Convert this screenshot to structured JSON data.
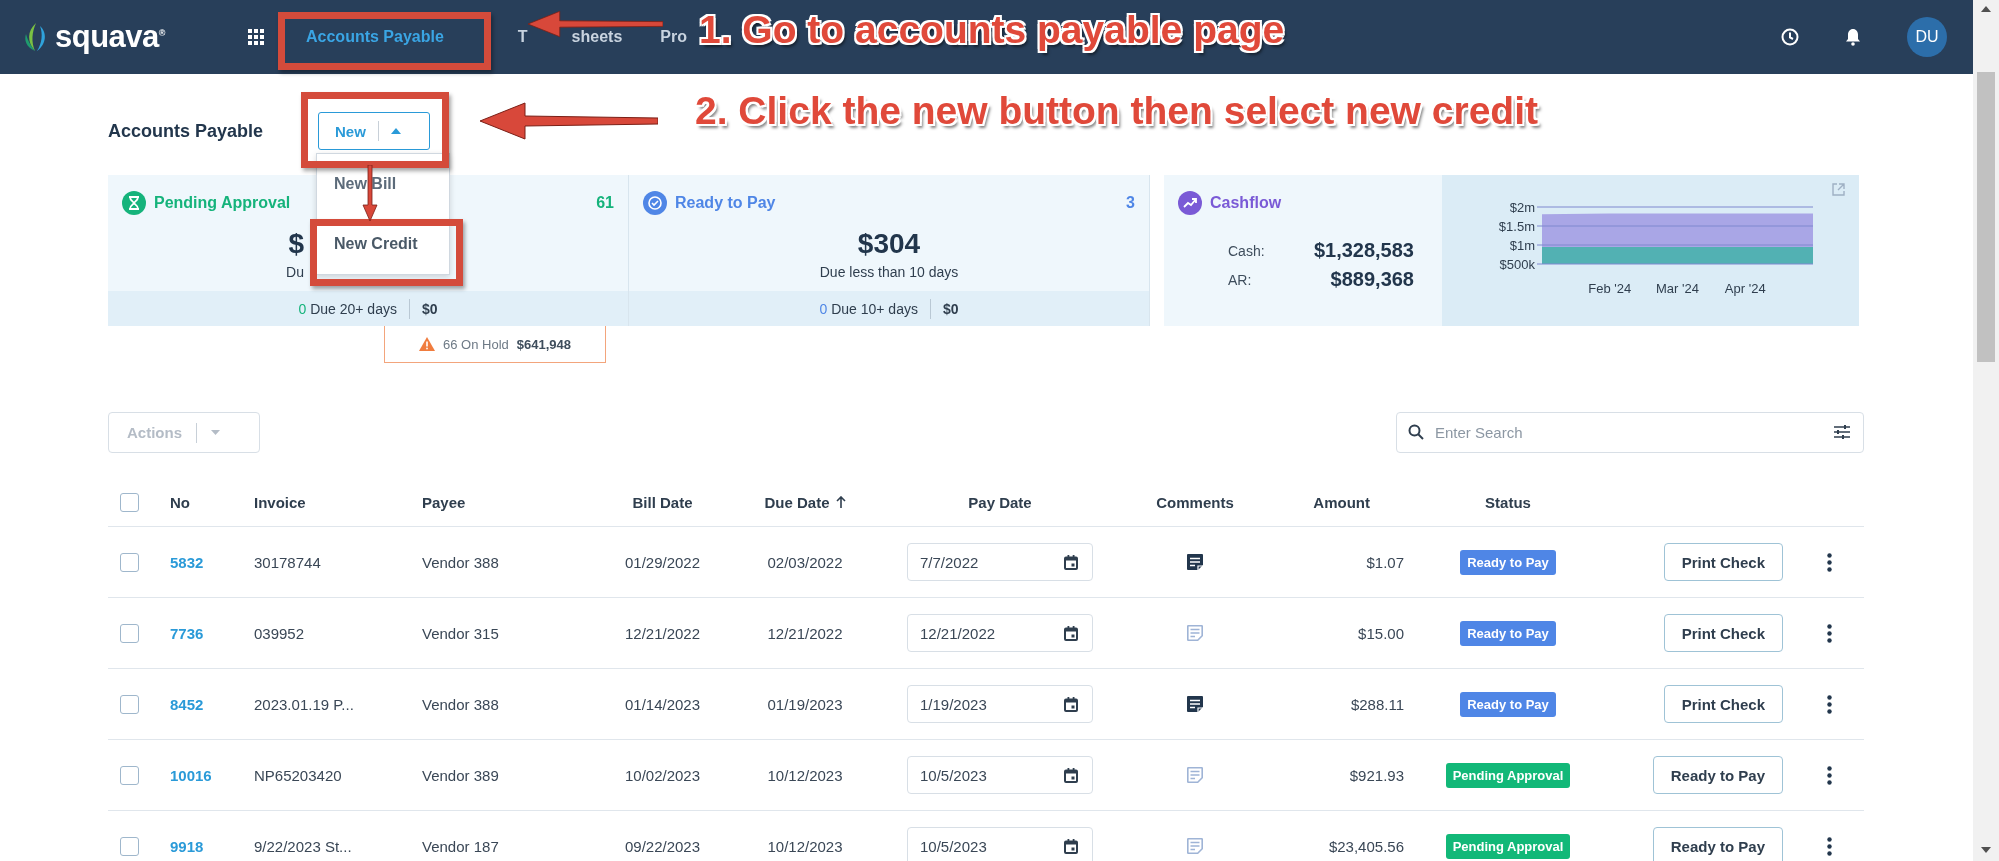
{
  "top_bar": {
    "logo": "squava$^{®}$",
    "nav": [
      {
        "label": "Accounts Payable",
        "selected": true
      },
      {
        "label": "T",
        "label_tail": "sheets",
        "selected": false
      },
      {
        "label": "Pro",
        "selected": false
      }
    ],
    "avatar": "DU"
  },
  "page_title": "Accounts Payable",
  "new_button": {
    "label": "New",
    "expanded": true,
    "menu": [
      {
        "label": "New Bill",
        "highlighted": false
      },
      {
        "label": "New Credit",
        "highlighted": true
      }
    ]
  },
  "cards": [
    {
      "title": "Pending Approval",
      "count": "61",
      "color": "#15b37b",
      "amount": "$",
      "due": "Du",
      "footer_count": "0",
      "footer_label": "Due 20+ days",
      "footer_amount": "$0"
    },
    {
      "title": "Ready to Pay",
      "count": "3",
      "color": "#4f86e6",
      "amount": "$304",
      "due": "Due less than 10 days",
      "footer_count": "0",
      "footer_label": "Due 10+ days",
      "footer_amount": "$0"
    }
  ],
  "on_hold": {
    "label": "66 On Hold",
    "amount": "$641,948"
  },
  "cashflow": {
    "title": "Cashflow",
    "cash_label": "Cash:",
    "cash": "$1,328,583",
    "ar_label": "AR:",
    "ar": "$889,368",
    "chart_data": {
      "type": "area",
      "stacked": false,
      "categories": [
        null,
        "Feb '24",
        "Mar '24",
        "Apr '24",
        null
      ],
      "series": [
        {
          "color": "#a9a6e6",
          "values": [
            1810000,
            1830000,
            1830000,
            1830000,
            1830000
          ]
        },
        {
          "color": "#52b1b3",
          "values": [
            950000,
            950000,
            950000,
            950000,
            950000
          ]
        }
      ],
      "ylim": [
        500000,
        2000000
      ],
      "yticks": [
        {
          "value": 500000,
          "label": "$500k"
        },
        {
          "value": 1000000,
          "label": "$1m"
        },
        {
          "value": 1500000,
          "label": "$1.5m"
        },
        {
          "value": 2000000,
          "label": "$2m"
        }
      ]
    }
  },
  "actions": {
    "label": "Actions",
    "disabled": true
  },
  "search": {
    "placeholder": "Enter Search"
  },
  "table": {
    "all_checked": false,
    "columns": [
      {
        "label": "No",
        "sorted": false
      },
      {
        "label": "Invoice",
        "sorted": false
      },
      {
        "label": "Payee",
        "sorted": false
      },
      {
        "label": "Bill Date",
        "sorted": false
      },
      {
        "label": "Due Date",
        "sorted": true
      },
      {
        "label": "Pay Date",
        "sorted": false
      },
      {
        "label": "Comments",
        "sorted": false
      },
      {
        "label": "Amount",
        "sorted": false
      },
      {
        "label": "Status",
        "sorted": false
      }
    ],
    "rows": [
      {
        "checked": false,
        "no": "5832",
        "invoice": "30178744",
        "payee": "Vendor 388",
        "bill_date": "01/29/2022",
        "due_date": "02/03/2022",
        "pay_date": "7/7/2022",
        "has_comment": true,
        "amount": "$1.07",
        "status": "Ready to Pay",
        "color": "#4f86e6",
        "action": "Print Check"
      },
      {
        "checked": false,
        "no": "7736",
        "invoice": "039952",
        "payee": "Vendor 315",
        "bill_date": "12/21/2022",
        "due_date": "12/21/2022",
        "pay_date": "12/21/2022",
        "has_comment": false,
        "amount": "$15.00",
        "status": "Ready to Pay",
        "color": "#4f86e6",
        "action": "Print Check"
      },
      {
        "checked": false,
        "no": "8452",
        "invoice": "2023.01.19 P...",
        "payee": "Vendor 388",
        "bill_date": "01/14/2023",
        "due_date": "01/19/2023",
        "pay_date": "1/19/2023",
        "has_comment": true,
        "amount": "$288.11",
        "status": "Ready to Pay",
        "color": "#4f86e6",
        "action": "Print Check"
      },
      {
        "checked": false,
        "no": "10016",
        "invoice": "NP65203420",
        "payee": "Vendor 389",
        "bill_date": "10/02/2023",
        "due_date": "10/12/2023",
        "pay_date": "10/5/2023",
        "has_comment": false,
        "amount": "$921.93",
        "status": "Pending Approval",
        "color": "#12b878",
        "action": "Ready to Pay"
      },
      {
        "checked": false,
        "no": "9918",
        "invoice": "9/22/2023 St...",
        "payee": "Vendor 187",
        "bill_date": "09/22/2023",
        "due_date": "10/12/2023",
        "pay_date": "10/5/2023",
        "has_comment": false,
        "amount": "$23,405.56",
        "status": "Pending Approval",
        "color": "#12b878",
        "action": "Ready to Pay"
      }
    ]
  },
  "annotations": [
    {
      "text": "1. Go to accounts payable page"
    },
    {
      "text": "2. Click the new button then select new credit"
    }
  ]
}
